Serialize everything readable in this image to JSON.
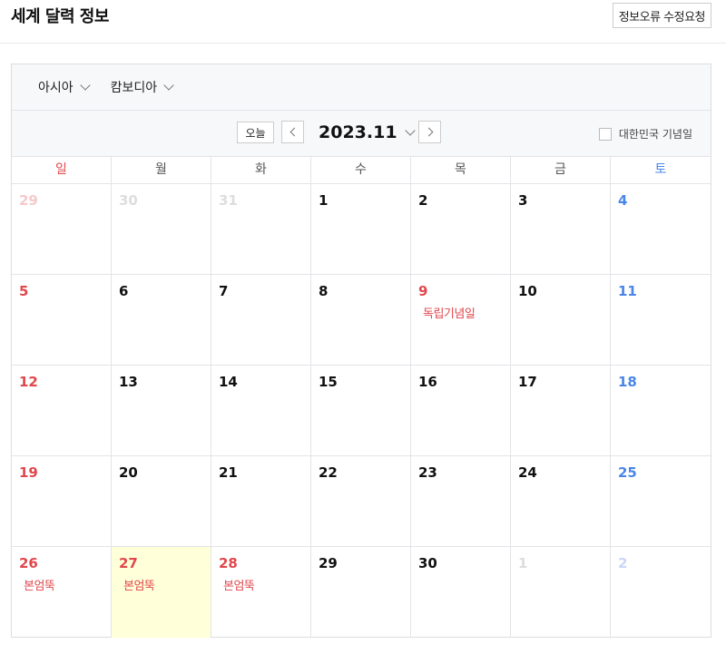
{
  "header": {
    "title": "세계 달력 정보",
    "report_button": "정보오류 수정요청"
  },
  "filters": {
    "continent": "아시아",
    "country": "캄보디아"
  },
  "nav": {
    "today_label": "오늘",
    "month": "2023.11",
    "korea_label": "대한민국 기념일",
    "korea_checked": false
  },
  "colors": {
    "sunday": "#e0474c",
    "saturday": "#4a86e8",
    "weekday": "#111111",
    "outside_sunday": "#f5c9c9",
    "outside_weekday": "#dddddd",
    "outside_saturday": "#c9d7f5",
    "today_bg": "#ffffd9",
    "holiday_text": "#e0474c"
  },
  "weekdays": [
    "일",
    "월",
    "화",
    "수",
    "목",
    "금",
    "토"
  ],
  "weeks": [
    [
      {
        "day": "29",
        "outside": true
      },
      {
        "day": "30",
        "outside": true
      },
      {
        "day": "31",
        "outside": true
      },
      {
        "day": "1"
      },
      {
        "day": "2"
      },
      {
        "day": "3"
      },
      {
        "day": "4"
      }
    ],
    [
      {
        "day": "5"
      },
      {
        "day": "6"
      },
      {
        "day": "7"
      },
      {
        "day": "8"
      },
      {
        "day": "9",
        "holiday": "독립기념일",
        "red": true
      },
      {
        "day": "10"
      },
      {
        "day": "11"
      }
    ],
    [
      {
        "day": "12"
      },
      {
        "day": "13"
      },
      {
        "day": "14"
      },
      {
        "day": "15"
      },
      {
        "day": "16"
      },
      {
        "day": "17"
      },
      {
        "day": "18"
      }
    ],
    [
      {
        "day": "19"
      },
      {
        "day": "20"
      },
      {
        "day": "21"
      },
      {
        "day": "22"
      },
      {
        "day": "23"
      },
      {
        "day": "24"
      },
      {
        "day": "25"
      }
    ],
    [
      {
        "day": "26",
        "holiday": "본엄뚝",
        "red": true
      },
      {
        "day": "27",
        "holiday": "본엄뚝",
        "red": true,
        "today": true
      },
      {
        "day": "28",
        "holiday": "본엄뚝",
        "red": true
      },
      {
        "day": "29"
      },
      {
        "day": "30"
      },
      {
        "day": "1",
        "outside": true
      },
      {
        "day": "2",
        "outside": true
      }
    ]
  ]
}
